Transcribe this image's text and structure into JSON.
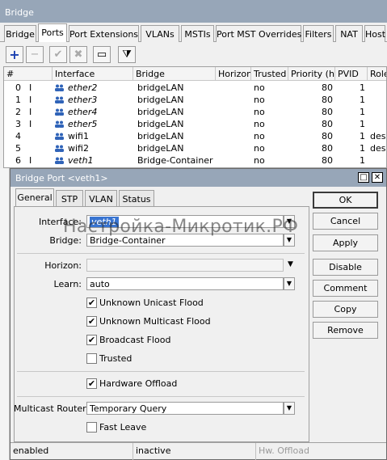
{
  "window": {
    "title": "Bridge"
  },
  "tabs": [
    {
      "label": "Bridge",
      "active": false
    },
    {
      "label": "Ports",
      "active": true
    },
    {
      "label": "Port Extensions",
      "active": false
    },
    {
      "label": "VLANs",
      "active": false
    },
    {
      "label": "MSTIs",
      "active": false
    },
    {
      "label": "Port MST Overrides",
      "active": false
    },
    {
      "label": "Filters",
      "active": false
    },
    {
      "label": "NAT",
      "active": false
    },
    {
      "label": "Host",
      "active": false
    }
  ],
  "toolbar": {
    "add": "+",
    "remove": "−",
    "enable": "✔",
    "disable": "✖",
    "comment": "▭",
    "filter": "⧩"
  },
  "grid": {
    "columns": [
      "#",
      "Interface",
      "Bridge",
      "Horizon",
      "Trusted",
      "Priority (h...",
      "PVID",
      "Role"
    ],
    "rows": [
      {
        "n": "0",
        "flag": "I",
        "iface": "ether2",
        "italic": true,
        "bridge": "bridgeLAN",
        "horizon": "",
        "trusted": "no",
        "priority": "80",
        "pvid": "1",
        "role": ""
      },
      {
        "n": "1",
        "flag": "I",
        "iface": "ether3",
        "italic": true,
        "bridge": "bridgeLAN",
        "horizon": "",
        "trusted": "no",
        "priority": "80",
        "pvid": "1",
        "role": ""
      },
      {
        "n": "2",
        "flag": "I",
        "iface": "ether4",
        "italic": true,
        "bridge": "bridgeLAN",
        "horizon": "",
        "trusted": "no",
        "priority": "80",
        "pvid": "1",
        "role": ""
      },
      {
        "n": "3",
        "flag": "I",
        "iface": "ether5",
        "italic": true,
        "bridge": "bridgeLAN",
        "horizon": "",
        "trusted": "no",
        "priority": "80",
        "pvid": "1",
        "role": ""
      },
      {
        "n": "4",
        "flag": "",
        "iface": "wifi1",
        "italic": false,
        "bridge": "bridgeLAN",
        "horizon": "",
        "trusted": "no",
        "priority": "80",
        "pvid": "1",
        "role": "desig"
      },
      {
        "n": "5",
        "flag": "",
        "iface": "wifi2",
        "italic": false,
        "bridge": "bridgeLAN",
        "horizon": "",
        "trusted": "no",
        "priority": "80",
        "pvid": "1",
        "role": "desig"
      },
      {
        "n": "6",
        "flag": "I",
        "iface": "veth1",
        "italic": true,
        "bridge": "Bridge-Container",
        "horizon": "",
        "trusted": "no",
        "priority": "80",
        "pvid": "1",
        "role": ""
      }
    ]
  },
  "dialog": {
    "title": "Bridge Port <veth1>",
    "tabs": [
      "General",
      "STP",
      "VLAN",
      "Status"
    ],
    "interface_label": "Interface:",
    "interface_value": "veth1",
    "bridge_label": "Bridge:",
    "bridge_value": "Bridge-Container",
    "horizon_label": "Horizon:",
    "horizon_value": "",
    "learn_label": "Learn:",
    "learn_value": "auto",
    "checkboxes": [
      {
        "label": "Unknown Unicast Flood",
        "checked": true
      },
      {
        "label": "Unknown Multicast Flood",
        "checked": true
      },
      {
        "label": "Broadcast Flood",
        "checked": true
      },
      {
        "label": "Trusted",
        "checked": false
      }
    ],
    "hw_offload": {
      "label": "Hardware Offload",
      "checked": true
    },
    "multicast_router_label": "Multicast Router:",
    "multicast_router_value": "Temporary Query",
    "fast_leave": {
      "label": "Fast Leave",
      "checked": false
    },
    "buttons": {
      "ok": "OK",
      "cancel": "Cancel",
      "apply": "Apply",
      "disable": "Disable",
      "comment": "Comment",
      "copy": "Copy",
      "remove": "Remove"
    },
    "status": {
      "state": "enabled",
      "activity": "inactive",
      "hw": "Hw. Offload"
    }
  },
  "watermark": "Настройка-Микротик.РФ",
  "colors": {
    "titlebar": "#97a6b8",
    "selection": "#3874d1",
    "add_icon": "#1a3fb0"
  }
}
